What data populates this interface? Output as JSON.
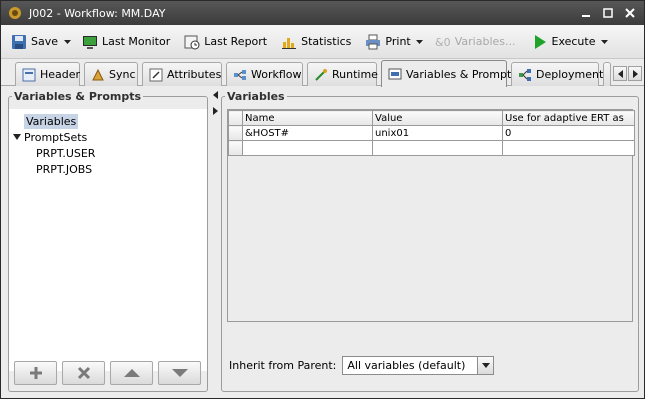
{
  "window": {
    "title": "J002 - Workflow: MM.DAY"
  },
  "toolbar": {
    "save": "Save",
    "last_monitor": "Last Monitor",
    "last_report": "Last Report",
    "statistics": "Statistics",
    "print": "Print",
    "variables": "Variables...",
    "execute": "Execute"
  },
  "tabs": [
    {
      "label": "Header",
      "icon": "header-icon"
    },
    {
      "label": "Sync",
      "icon": "sync-icon"
    },
    {
      "label": "Attributes",
      "icon": "attributes-icon"
    },
    {
      "label": "Workflow",
      "icon": "workflow-icon"
    },
    {
      "label": "Runtime",
      "icon": "runtime-icon"
    },
    {
      "label": "Variables & Prompts",
      "icon": "variables-prompts-icon",
      "active": true
    },
    {
      "label": "Deployment",
      "icon": "deployment-icon"
    }
  ],
  "left_panel": {
    "title": "Variables & Prompts",
    "tree": {
      "variables": "Variables",
      "promptsets": "PromptSets",
      "children": [
        "PRPT.USER",
        "PRPT.JOBS"
      ]
    }
  },
  "right_panel": {
    "title": "Variables",
    "columns": [
      "Name",
      "Value",
      "Use for adaptive ERT as"
    ],
    "rows": [
      {
        "name": "&HOST#",
        "value": "unix01",
        "ert": "0"
      },
      {
        "name": "",
        "value": "",
        "ert": ""
      }
    ],
    "inherit_label": "Inherit from Parent:",
    "inherit_value": "All variables (default)"
  },
  "colors": {
    "titlebar": "#3c3c3c",
    "execute_green": "#1fa32a",
    "selection": "#c7d4e6"
  }
}
